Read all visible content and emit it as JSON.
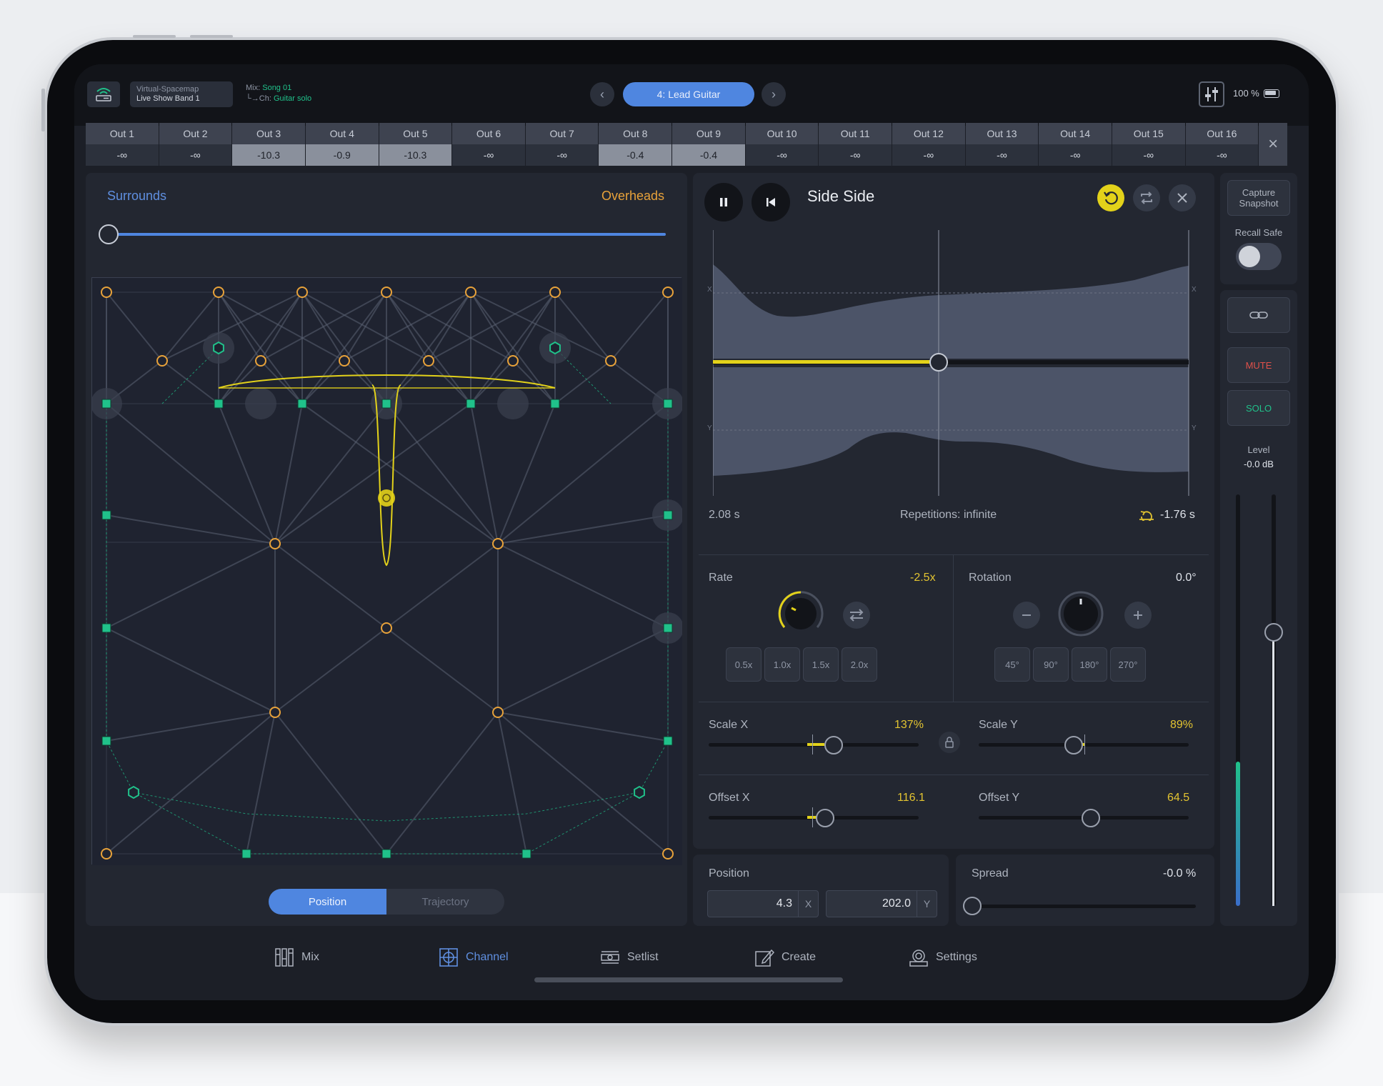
{
  "header": {
    "project_line1": "Virtual-Spacemap",
    "project_line2": "Live Show Band 1",
    "mix_label": "Mix:",
    "mix_value": "Song 01",
    "ch_label": "└→Ch:",
    "ch_value": "Guitar solo",
    "channel_name": "4: Lead Guitar",
    "battery": "100 %"
  },
  "outputs": [
    {
      "name": "Out 1",
      "value": "-∞",
      "hi": false
    },
    {
      "name": "Out 2",
      "value": "-∞",
      "hi": false
    },
    {
      "name": "Out 3",
      "value": "-10.3",
      "hi": true
    },
    {
      "name": "Out 4",
      "value": "-0.9",
      "hi": true
    },
    {
      "name": "Out 5",
      "value": "-10.3",
      "hi": true
    },
    {
      "name": "Out 6",
      "value": "-∞",
      "hi": false
    },
    {
      "name": "Out 7",
      "value": "-∞",
      "hi": false
    },
    {
      "name": "Out 8",
      "value": "-0.4",
      "hi": true
    },
    {
      "name": "Out 9",
      "value": "-0.4",
      "hi": true
    },
    {
      "name": "Out 10",
      "value": "-∞",
      "hi": false
    },
    {
      "name": "Out 11",
      "value": "-∞",
      "hi": false
    },
    {
      "name": "Out 12",
      "value": "-∞",
      "hi": false
    },
    {
      "name": "Out 13",
      "value": "-∞",
      "hi": false
    },
    {
      "name": "Out 14",
      "value": "-∞",
      "hi": false
    },
    {
      "name": "Out 15",
      "value": "-∞",
      "hi": false
    },
    {
      "name": "Out 16",
      "value": "-∞",
      "hi": false
    }
  ],
  "spacemap": {
    "left_label": "Surrounds",
    "right_label": "Overheads",
    "mode_position": "Position",
    "mode_trajectory": "Trajectory"
  },
  "trajectory": {
    "title": "Side Side",
    "axis_x": "X",
    "axis_y": "Y",
    "duration": "2.08 s",
    "repetitions": "Repetitions: infinite",
    "offset_time": "-1.76 s",
    "rate_label": "Rate",
    "rate_value": "-2.5x",
    "rate_chips": [
      "0.5x",
      "1.0x",
      "1.5x",
      "2.0x"
    ],
    "rotation_label": "Rotation",
    "rotation_value": "0.0°",
    "rotation_chips": [
      "45°",
      "90°",
      "180°",
      "270°"
    ],
    "scale_x_label": "Scale X",
    "scale_x_value": "137%",
    "scale_y_label": "Scale Y",
    "scale_y_value": "89%",
    "offset_x_label": "Offset X",
    "offset_x_value": "116.1",
    "offset_y_label": "Offset Y",
    "offset_y_value": "64.5"
  },
  "position": {
    "label": "Position",
    "x": "4.3",
    "x_unit": "X",
    "y": "202.0",
    "y_unit": "Y"
  },
  "spread": {
    "label": "Spread",
    "value": "-0.0 %"
  },
  "right_column": {
    "capture_line1": "Capture",
    "capture_line2": "Snapshot",
    "recall_safe": "Recall Safe",
    "mute": "MUTE",
    "solo": "SOLO",
    "level_label": "Level",
    "level_value": "-0.0 dB",
    "mute_color": "#e0504a",
    "solo_color": "#20c18a"
  },
  "tabs": [
    {
      "label": "Mix",
      "icon": "grid-faders-icon"
    },
    {
      "label": "Channel",
      "icon": "channel-target-icon"
    },
    {
      "label": "Setlist",
      "icon": "setlist-icon"
    },
    {
      "label": "Create",
      "icon": "create-pencil-icon"
    },
    {
      "label": "Settings",
      "icon": "settings-gear-icon"
    }
  ],
  "colors": {
    "accent_blue": "#4f86e0",
    "accent_yellow": "#e3c431",
    "speaker_orange": "#e8a23a",
    "speaker_green": "#20c18a"
  }
}
